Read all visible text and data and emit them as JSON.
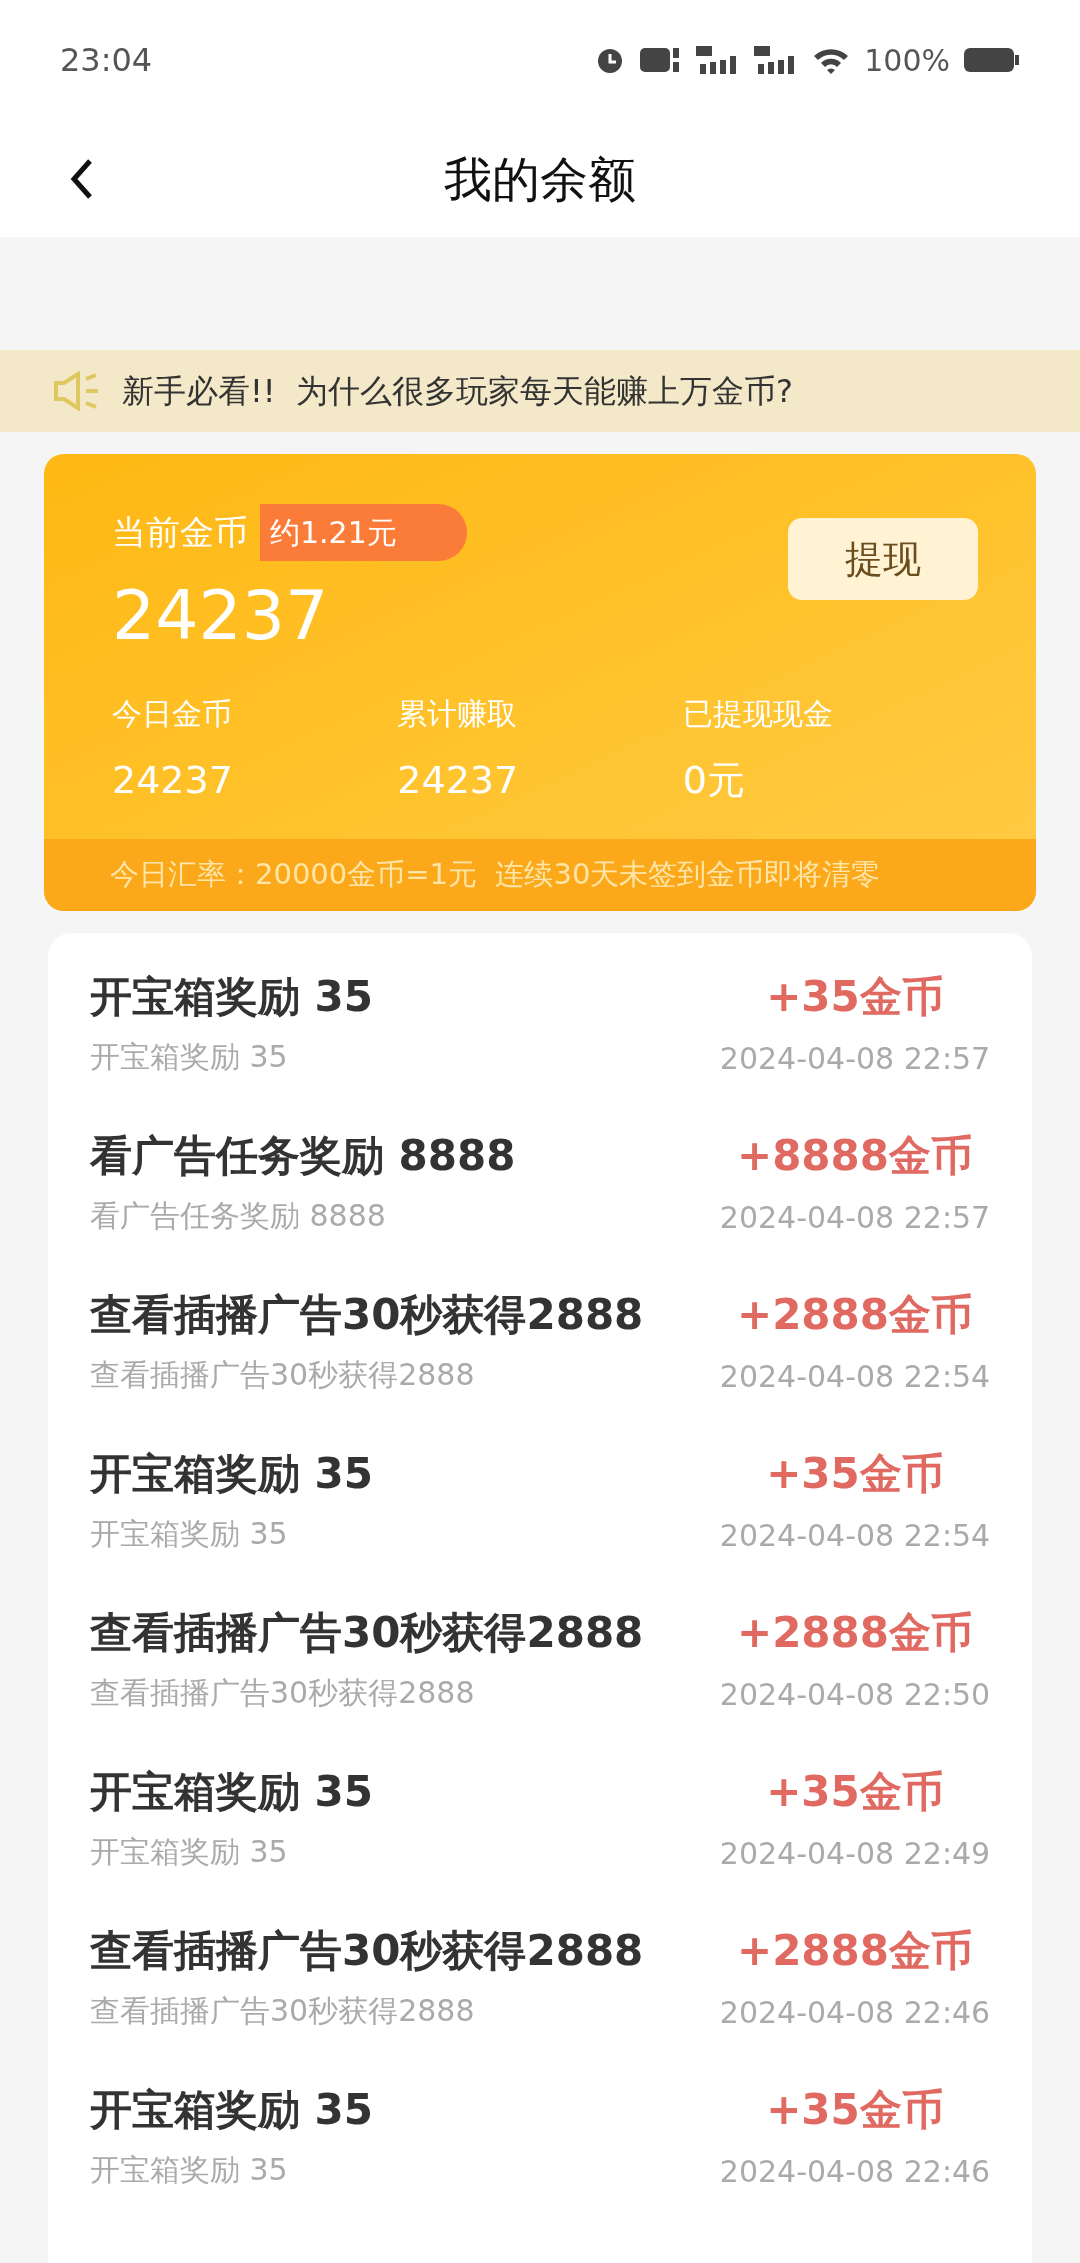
{
  "status_bar": {
    "time": "23:04",
    "battery": "100%"
  },
  "header": {
    "title": "我的余额"
  },
  "notice": {
    "text": "新手必看!!  为什么很多玩家每天能赚上万金币?"
  },
  "balance": {
    "label": "当前金币",
    "approx": "约1.21元",
    "amount": "24237",
    "withdraw_button": "提现",
    "stats": [
      {
        "label": "今日金币",
        "value": "24237"
      },
      {
        "label": "累计赚取",
        "value": "24237"
      },
      {
        "label": "已提现现金",
        "value": "0元"
      }
    ],
    "footer": "今日汇率：20000金币=1元  连续30天未签到金币即将清零"
  },
  "records": [
    {
      "title": "开宝箱奖励 35",
      "subtitle": "开宝箱奖励 35",
      "amount": "+35金币",
      "time": "2024-04-08 22:57"
    },
    {
      "title": "看广告任务奖励 8888",
      "subtitle": "看广告任务奖励 8888",
      "amount": "+8888金币",
      "time": "2024-04-08 22:57"
    },
    {
      "title": "查看插播广告30秒获得2888",
      "subtitle": "查看插播广告30秒获得2888",
      "amount": "+2888金币",
      "time": "2024-04-08 22:54"
    },
    {
      "title": "开宝箱奖励 35",
      "subtitle": "开宝箱奖励 35",
      "amount": "+35金币",
      "time": "2024-04-08 22:54"
    },
    {
      "title": "查看插播广告30秒获得2888",
      "subtitle": "查看插播广告30秒获得2888",
      "amount": "+2888金币",
      "time": "2024-04-08 22:50"
    },
    {
      "title": "开宝箱奖励 35",
      "subtitle": "开宝箱奖励 35",
      "amount": "+35金币",
      "time": "2024-04-08 22:49"
    },
    {
      "title": "查看插播广告30秒获得2888",
      "subtitle": "查看插播广告30秒获得2888",
      "amount": "+2888金币",
      "time": "2024-04-08 22:46"
    },
    {
      "title": "开宝箱奖励 35",
      "subtitle": "开宝箱奖励 35",
      "amount": "+35金币",
      "time": "2024-04-08 22:46"
    }
  ]
}
